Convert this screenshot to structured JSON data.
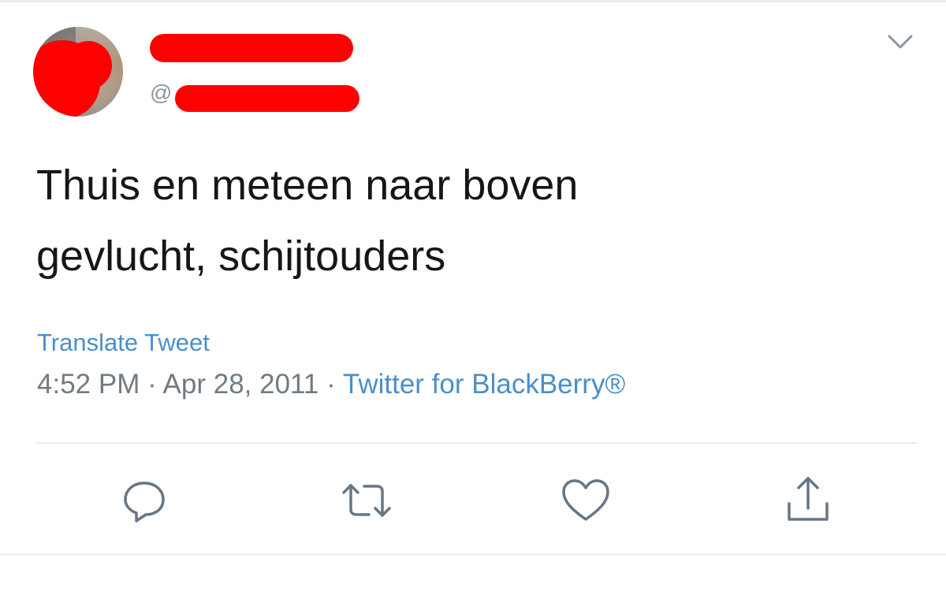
{
  "tweet": {
    "handle_prefix": "@",
    "text_line1": "Thuis en meteen naar boven",
    "text_line2": "gevlucht, schijtouders",
    "translate_label": "Translate Tweet",
    "time": "4:52 PM",
    "separator": " · ",
    "date": "Apr 28, 2011",
    "source": "Twitter for BlackBerry®"
  },
  "actions": {
    "icons": [
      "reply-icon",
      "retweet-icon",
      "like-icon",
      "share-icon"
    ]
  },
  "colors": {
    "text": "#14171a",
    "secondary": "#707b84",
    "link": "#4a8fca",
    "redaction": "#ff0000",
    "icon": "#657786"
  }
}
